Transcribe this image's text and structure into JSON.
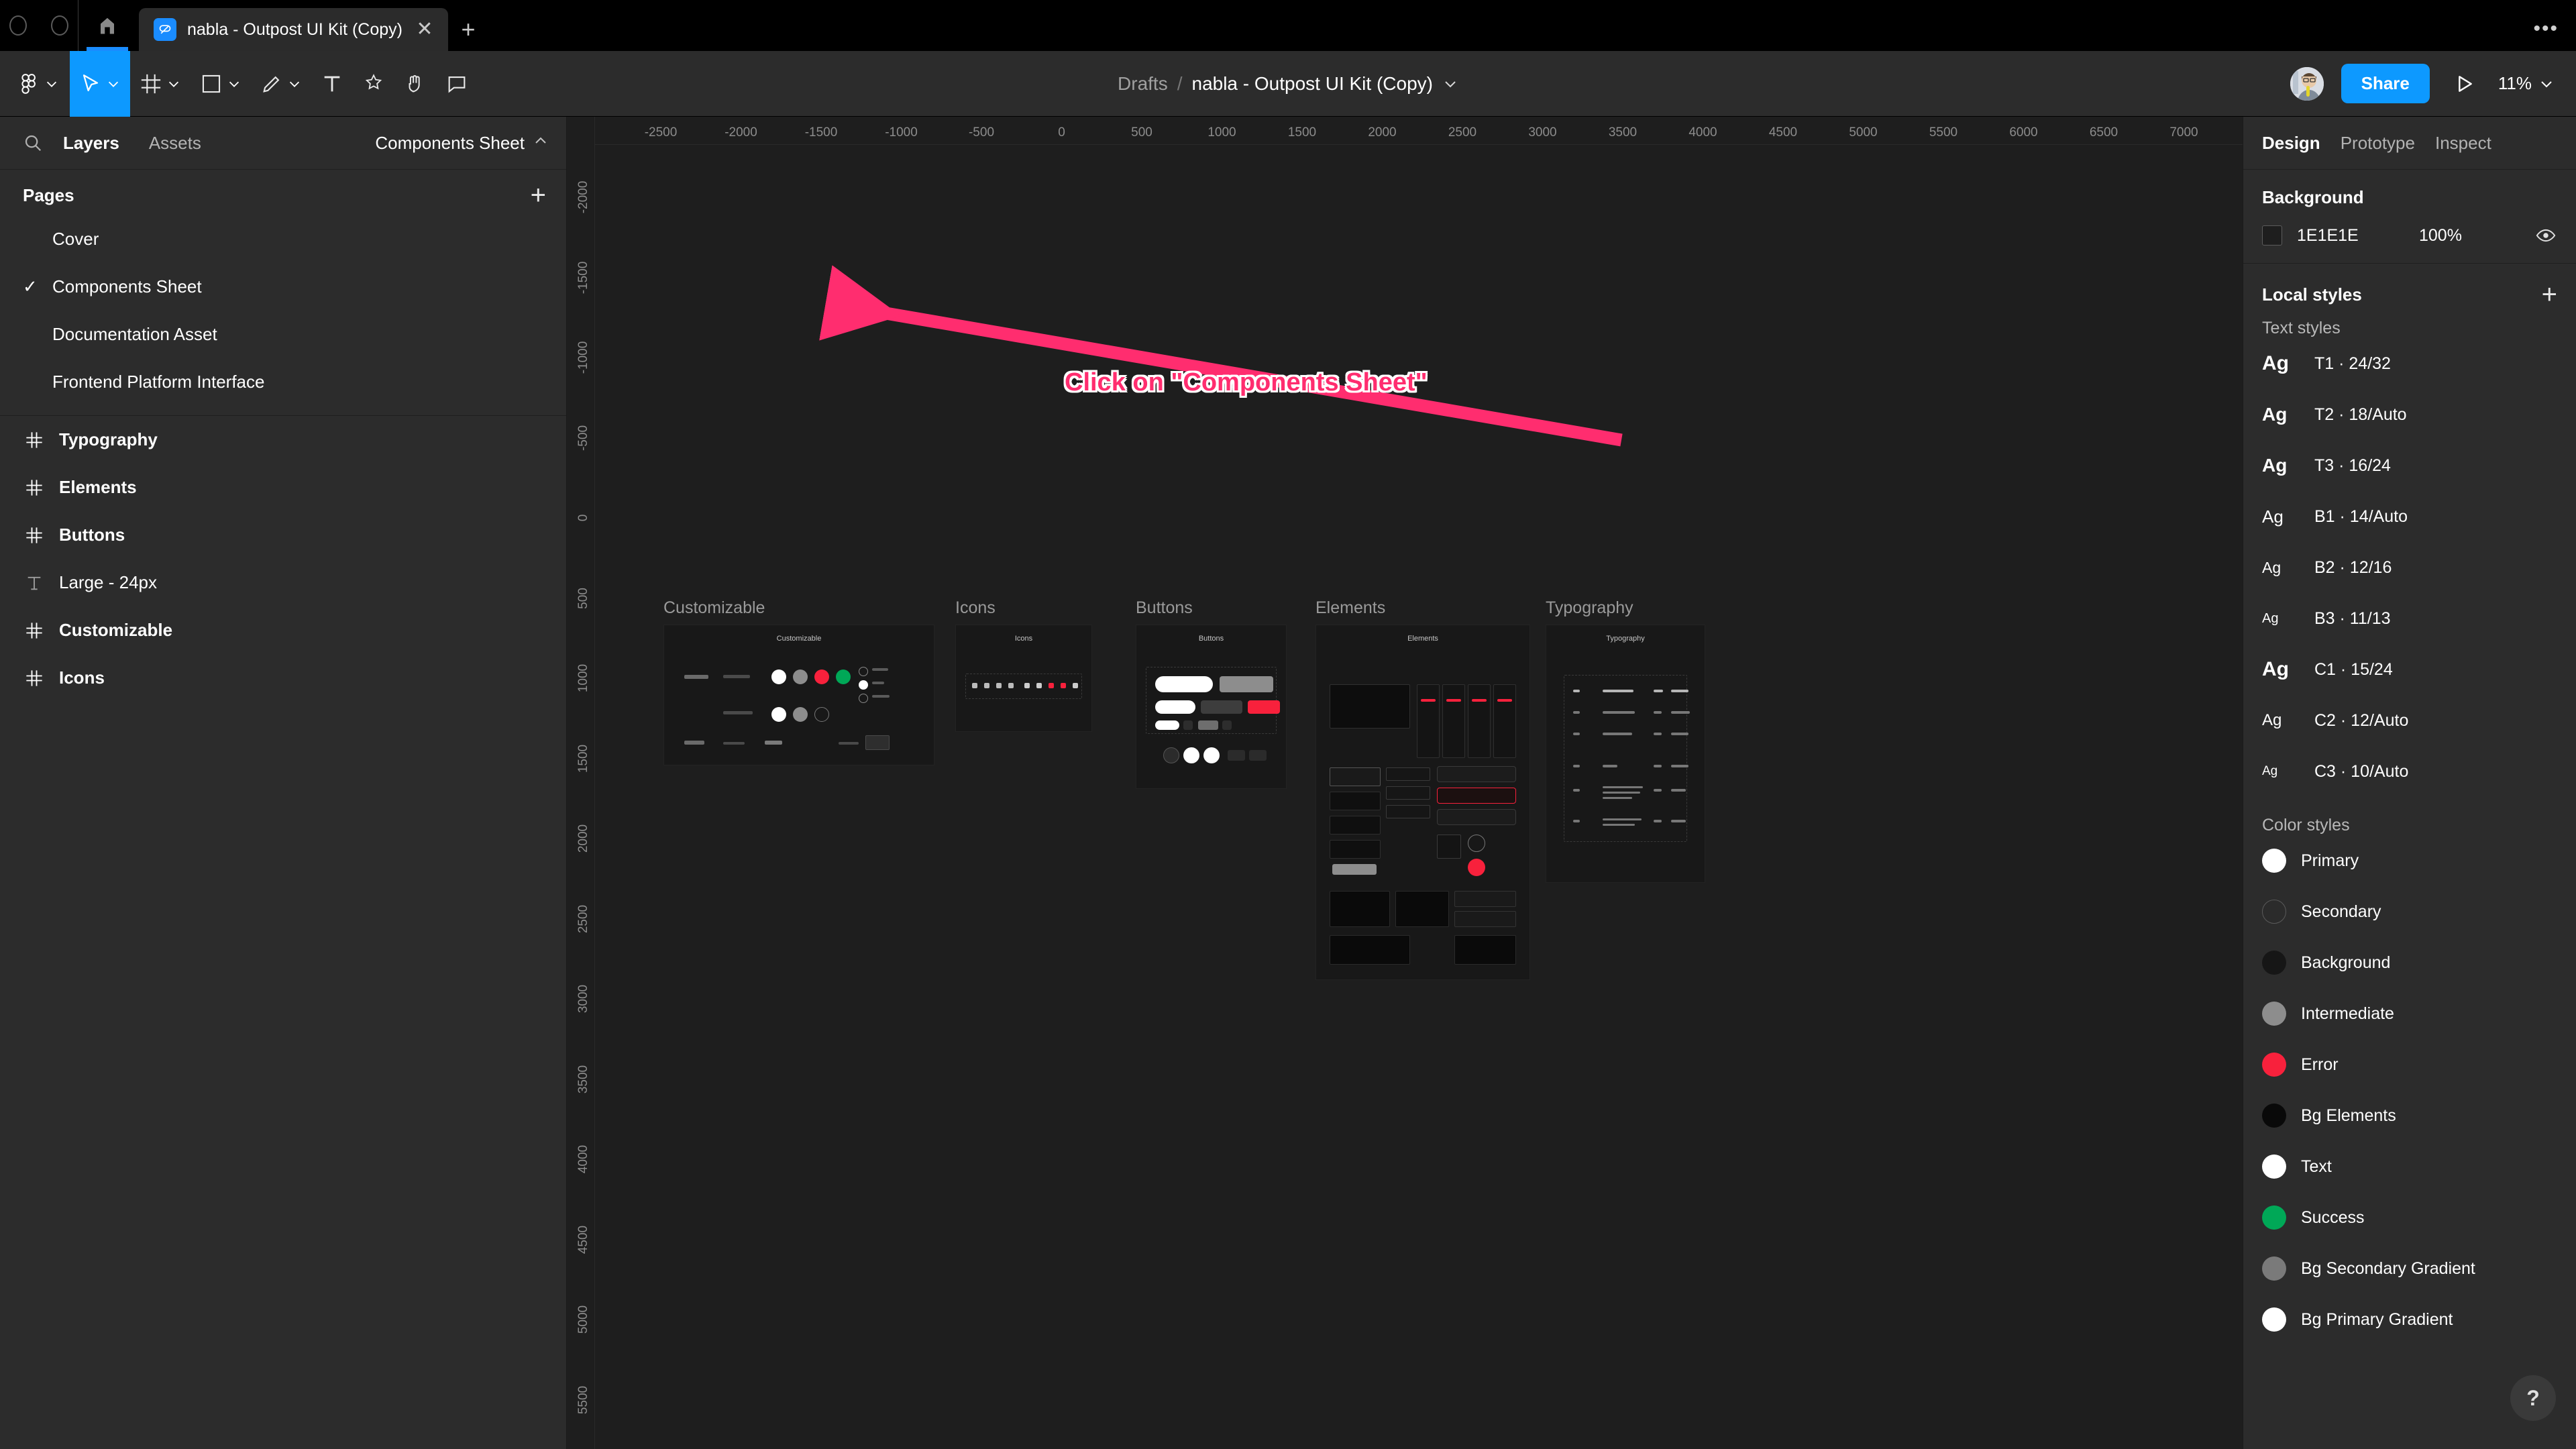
{
  "browser": {
    "tab_title": "nabla - Outpost UI Kit (Copy)",
    "close_glyph": "✕",
    "new_tab_glyph": "+",
    "menu_glyph": "•••"
  },
  "toolbar": {
    "breadcrumb": {
      "project": "Drafts",
      "separator": "/",
      "file": "nabla - Outpost UI Kit (Copy)"
    },
    "share_label": "Share",
    "zoom_level": "11%"
  },
  "left_panel": {
    "tabs": [
      {
        "label": "Layers",
        "active": true
      },
      {
        "label": "Assets",
        "active": false
      }
    ],
    "page_selector": "Components Sheet",
    "pages_header": {
      "label": "Pages",
      "add_glyph": "+"
    },
    "pages": [
      {
        "label": "Cover",
        "selected": false,
        "check": ""
      },
      {
        "label": "Components Sheet",
        "selected": true,
        "check": "✓"
      },
      {
        "label": "Documentation Asset",
        "selected": false,
        "check": ""
      },
      {
        "label": "Frontend Platform Interface",
        "selected": false,
        "check": ""
      }
    ],
    "layers": [
      {
        "label": "Typography",
        "icon": "component-icon"
      },
      {
        "label": "Elements",
        "icon": "component-icon"
      },
      {
        "label": "Buttons",
        "icon": "component-icon"
      },
      {
        "label": "Large - 24px",
        "icon": "text-icon"
      },
      {
        "label": "Customizable",
        "icon": "component-icon"
      },
      {
        "label": "Icons",
        "icon": "component-icon"
      }
    ]
  },
  "canvas": {
    "ruler_top": [
      "-2500",
      "-2000",
      "-1500",
      "-1000",
      "-500",
      "0",
      "500",
      "1000",
      "1500",
      "2000",
      "2500",
      "3000",
      "3500",
      "4000",
      "4500",
      "5000",
      "5500",
      "6000",
      "6500",
      "7000"
    ],
    "ruler_left": [
      "-2000",
      "-1500",
      "-1000",
      "-500",
      "0",
      "500",
      "1000",
      "1500",
      "2000",
      "2500",
      "3000",
      "3500",
      "4000",
      "4500",
      "5000",
      "5500"
    ],
    "frames": [
      {
        "label": "Customizable",
        "title": "Customizable"
      },
      {
        "label": "Icons",
        "title": "Icons"
      },
      {
        "label": "Buttons",
        "title": "Buttons"
      },
      {
        "label": "Elements",
        "title": "Elements"
      },
      {
        "label": "Typography",
        "title": "Typography"
      }
    ],
    "annotation": {
      "text": "Click on \"Components Sheet\"",
      "color": "#ff2d6f"
    }
  },
  "right_panel": {
    "tabs": [
      {
        "label": "Design",
        "active": true
      },
      {
        "label": "Prototype",
        "active": false
      },
      {
        "label": "Inspect",
        "active": false
      }
    ],
    "background": {
      "heading": "Background",
      "hex": "1E1E1E",
      "opacity": "100%",
      "swatch_color": "#1e1e1e"
    },
    "local_styles": {
      "heading": "Local styles",
      "add_glyph": "+"
    },
    "text_styles_heading": "Text styles",
    "text_styles": [
      {
        "sample": "Ag",
        "name": "T1 · 24/32",
        "size": 30,
        "weight": "bold"
      },
      {
        "sample": "Ag",
        "name": "T2 · 18/Auto",
        "size": 28,
        "weight": "bold"
      },
      {
        "sample": "Ag",
        "name": "T3 · 16/24",
        "size": 28,
        "weight": "bold"
      },
      {
        "sample": "Ag",
        "name": "B1 · 14/Auto",
        "size": 26,
        "weight": "normal"
      },
      {
        "sample": "Ag",
        "name": "B2 · 12/16",
        "size": 23,
        "weight": "normal"
      },
      {
        "sample": "Ag",
        "name": "B3 · 11/13",
        "size": 20,
        "weight": "normal"
      },
      {
        "sample": "Ag",
        "name": "C1 · 15/24",
        "size": 30,
        "weight": "bold"
      },
      {
        "sample": "Ag",
        "name": "C2 · 12/Auto",
        "size": 24,
        "weight": "normal"
      },
      {
        "sample": "Ag",
        "name": "C3 · 10/Auto",
        "size": 19,
        "weight": "normal"
      }
    ],
    "color_styles_heading": "Color styles",
    "color_styles": [
      {
        "name": "Primary",
        "color": "#ffffff",
        "border": "none"
      },
      {
        "name": "Secondary",
        "color": "#2b2b2b",
        "border": "#5a5a5a"
      },
      {
        "name": "Background",
        "color": "#161616",
        "border": "none"
      },
      {
        "name": "Intermediate",
        "color": "#8d8d8d",
        "border": "none"
      },
      {
        "name": "Error",
        "color": "#f8213c",
        "border": "none"
      },
      {
        "name": "Bg Elements",
        "color": "#090909",
        "border": "none"
      },
      {
        "name": "Text",
        "color": "#ffffff",
        "border": "none"
      },
      {
        "name": "Success",
        "color": "#00a css",
        "border": "none"
      },
      {
        "name": "Bg Secondary Gradient",
        "color": "#757575",
        "border": "none"
      },
      {
        "name": "Bg Primary Gradient",
        "color": "#ffffff",
        "border": "none"
      }
    ],
    "help_glyph": "?"
  }
}
